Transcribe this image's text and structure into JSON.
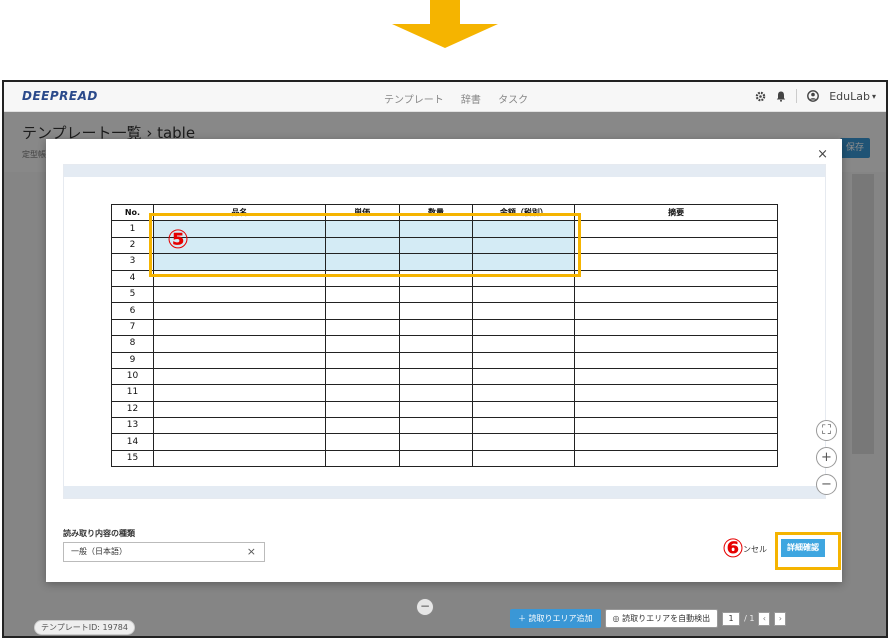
{
  "colors": {
    "arrow": "#f5b400",
    "accent": "#3a97d6",
    "highlight": "#f5b400",
    "step_number": "#e60000",
    "selection": "#d4ebf5"
  },
  "header": {
    "logo": "DEEPREAD",
    "nav": [
      "テンプレート",
      "辞書",
      "タスク"
    ],
    "user": "EduLab",
    "icons": [
      "gear-icon",
      "bell-icon",
      "user-icon",
      "chevron-down-icon"
    ]
  },
  "page": {
    "title": "テンプレート一覧 › table",
    "subtitle": "定型帳",
    "save": "保存",
    "template_id": "テンプレートID: 19784"
  },
  "modal": {
    "close": "×",
    "table": {
      "headers": [
        "No.",
        "品名",
        "単価",
        "数量",
        "金額（税別）",
        "摘要"
      ],
      "row_numbers": [
        "1",
        "2",
        "3",
        "4",
        "5",
        "6",
        "7",
        "8",
        "9",
        "10",
        "11",
        "12",
        "13",
        "14",
        "15"
      ],
      "selected_rows": 3
    },
    "zoom_controls": [
      "⛶",
      "+",
      "−"
    ],
    "read_type_label": "読み取り内容の種類",
    "read_type_value": "一般（日本語）",
    "cancel": "ンセル",
    "detail": "詳細確認"
  },
  "bottom_bar": {
    "add_area": "＋ 読取りエリア追加",
    "auto_detect": "◎ 読取りエリアを自動検出",
    "page_current": "1",
    "page_total": "/ 1"
  },
  "annotations": {
    "step5": "⑤",
    "step6": "⑥"
  }
}
